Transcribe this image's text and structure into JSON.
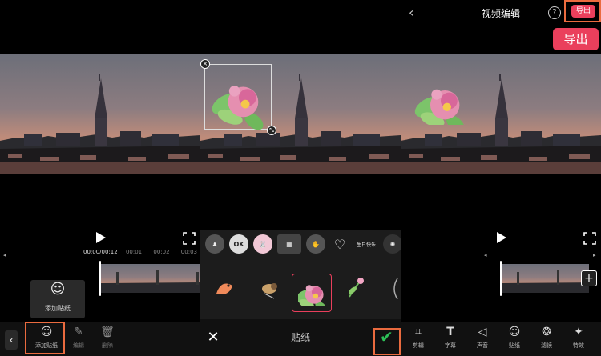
{
  "panel1": {
    "time_current": "00:00/00:12",
    "time_marks": [
      "00:01",
      "00:02",
      "00:03"
    ],
    "toolbar": [
      {
        "icon": "smiley-icon",
        "label": "添加贴纸"
      },
      {
        "icon": "pencil-icon",
        "label": "编辑"
      },
      {
        "icon": "trash-icon",
        "label": "删除"
      }
    ],
    "popup_label": "添加贴纸"
  },
  "panel2": {
    "title": "贴纸",
    "sticker_thumbs": [
      "OK",
      "",
      "",
      "",
      "",
      "生日快乐",
      ""
    ]
  },
  "panel3": {
    "title": "视频编辑",
    "export_small": "导出",
    "export_large": "导出",
    "toolbar": [
      {
        "icon": "crop-icon",
        "label": "剪辑"
      },
      {
        "icon": "text-icon",
        "label": "字幕"
      },
      {
        "icon": "speaker-icon",
        "label": "声音"
      },
      {
        "icon": "smiley-icon",
        "label": "贴纸"
      },
      {
        "icon": "filter-icon",
        "label": "滤镜"
      },
      {
        "icon": "sparkle-icon",
        "label": "特效"
      }
    ]
  },
  "colors": {
    "accent_red": "#ea3f5c",
    "highlight_orange": "#ea6b3f",
    "confirm_green": "#2dbf57"
  }
}
